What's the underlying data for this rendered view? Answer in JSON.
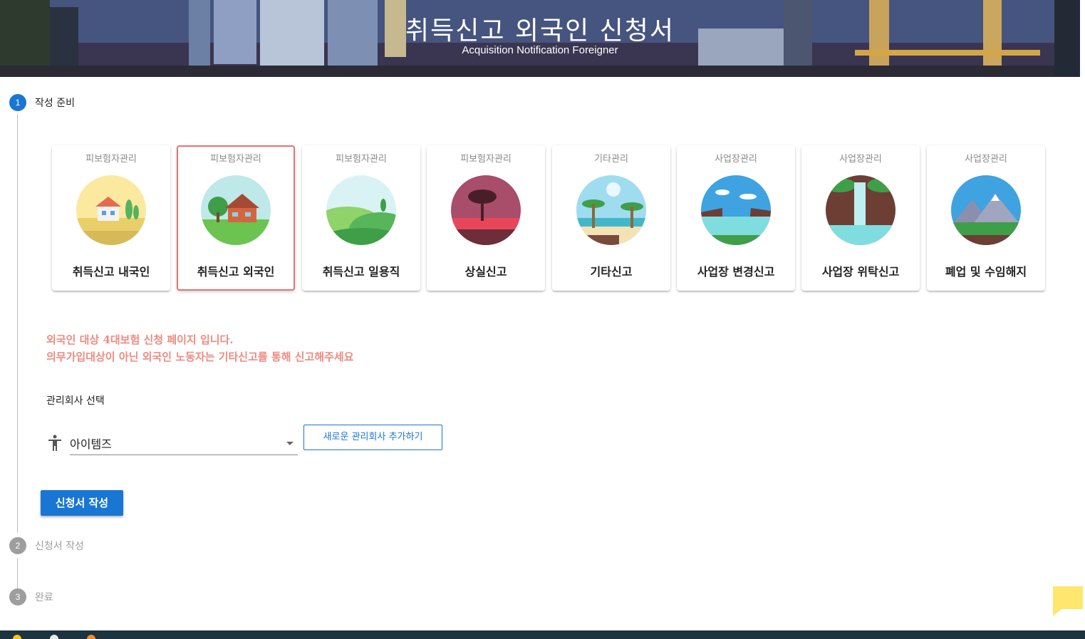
{
  "header": {
    "title": "취득신고 외국인 신청서",
    "subtitle": "Acquisition Notification Foreigner"
  },
  "steps": [
    {
      "number": "1",
      "label": "작성 준비",
      "state": "active"
    },
    {
      "number": "2",
      "label": "신청서 작성",
      "state": "inactive"
    },
    {
      "number": "3",
      "label": "완료",
      "state": "inactive"
    }
  ],
  "cards": [
    {
      "category": "피보험자관리",
      "label": "취득신고 내국인",
      "icon": "house-field-icon",
      "selected": false
    },
    {
      "category": "피보험자관리",
      "label": "취득신고 외국인",
      "icon": "house-tree-icon",
      "selected": true
    },
    {
      "category": "피보험자관리",
      "label": "취득신고 일용직",
      "icon": "green-hills-icon",
      "selected": false
    },
    {
      "category": "피보험자관리",
      "label": "상실신고",
      "icon": "sunset-tree-icon",
      "selected": false
    },
    {
      "category": "기타관리",
      "label": "기타신고",
      "icon": "palm-beach-icon",
      "selected": false
    },
    {
      "category": "사업장관리",
      "label": "사업장 변경신고",
      "icon": "lake-cliff-icon",
      "selected": false
    },
    {
      "category": "사업장관리",
      "label": "사업장 위탁신고",
      "icon": "waterfall-icon",
      "selected": false
    },
    {
      "category": "사업장관리",
      "label": "폐업 및 수임해지",
      "icon": "mountain-icon",
      "selected": false
    }
  ],
  "notice": {
    "line1": "외국인 대상 4대보험 신청 페이지 입니다.",
    "line2": "의무가입대상이 아닌 외국인 노동자는 기타신고를 통해 신고해주세요"
  },
  "company": {
    "section_label": "관리회사 선택",
    "selected_value": "아이템즈",
    "add_button": "새로운 관리회사 추가하기"
  },
  "actions": {
    "write_button": "신청서 작성"
  },
  "colors": {
    "primary": "#1976d2",
    "notice": "#ef8a80",
    "selected_border": "#e57373",
    "inactive_step": "#9e9e9e"
  }
}
